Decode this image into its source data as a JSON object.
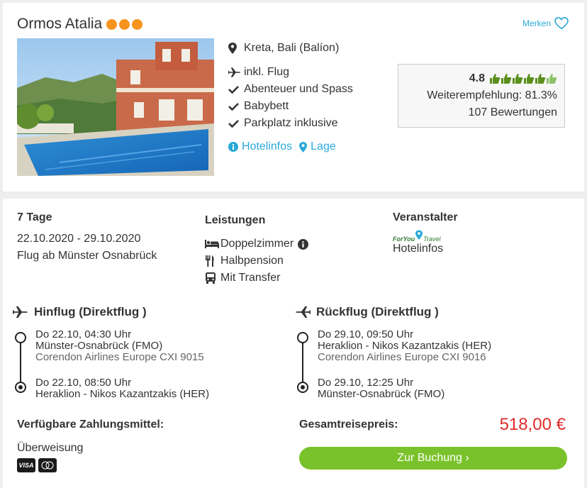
{
  "hotel": {
    "name": "Ormos Atalia",
    "stars": 3,
    "save_label": "Merken",
    "location": "Kreta, Bali (Balíon)",
    "features": [
      "inkl. Flug",
      "Abenteuer und Spass",
      "Babybett",
      "Parkplatz inklusive"
    ],
    "links": [
      "Hotelinfos",
      "Lage"
    ]
  },
  "rating": {
    "score": "4.8",
    "thumbs": 6,
    "recommendation": "Weiterempfehlung: 81.3%",
    "reviews": "107 Bewertungen"
  },
  "trip": {
    "duration": "7 Tage",
    "dates": "22.10.2020 - 29.10.2020",
    "departure": "Flug ab Münster Osnabrück"
  },
  "services": {
    "title": "Leistungen",
    "items": [
      "Doppelzimmer",
      "Halbpension",
      "Mit Transfer"
    ]
  },
  "operator": {
    "title": "Veranstalter",
    "logo_part1": "ForYou",
    "logo_part2": "Travel",
    "link": "Hotelinfos"
  },
  "outbound": {
    "title": "Hinflug (Direktflug )",
    "dep_time": "Do 22.10, 04:30 Uhr",
    "dep_airport": "Münster-Osnabrück (FMO)",
    "airline": "Corendon Airlines Europe CXI 9015",
    "arr_time": "Do 22.10, 08:50 Uhr",
    "arr_airport": "Heraklion - Nikos Kazantzakis (HER)"
  },
  "return": {
    "title": "Rückflug (Direktflug )",
    "dep_time": "Do 29.10, 09:50 Uhr",
    "dep_airport": "Heraklion - Nikos Kazantzakis (HER)",
    "airline": "Corendon Airlines Europe CXI 9016",
    "arr_time": "Do 29.10, 12:25 Uhr",
    "arr_airport": "Münster-Osnabrück (FMO)"
  },
  "payment": {
    "title": "Verfügbare Zahlungsmittel:",
    "method": "Überweisung",
    "cards": [
      "VISA",
      "mastercard"
    ]
  },
  "price": {
    "label": "Gesamtreisepreis:",
    "value": "518,00 €",
    "book_label": "Zur Buchung ›"
  },
  "colors": {
    "accent": "#2aa8d8",
    "price": "#e02b2b",
    "button": "#7ac22b",
    "stars": "#f7941d",
    "thumbs": "#5a8f1c"
  }
}
